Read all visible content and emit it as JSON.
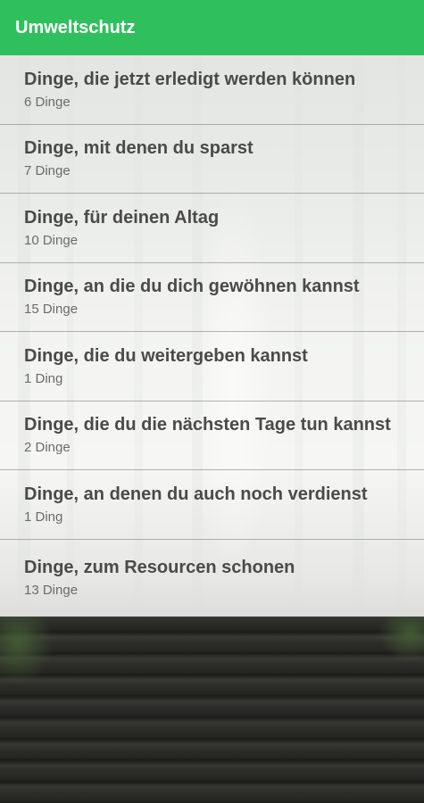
{
  "appbar": {
    "title": "Umweltschutz",
    "color": "#2fc05d"
  },
  "categories": [
    {
      "title": "Dinge, die jetzt erledigt werden können",
      "count": "6 Dinge"
    },
    {
      "title": "Dinge, mit denen du sparst",
      "count": "7 Dinge"
    },
    {
      "title": "Dinge, für deinen Altag",
      "count": "10 Dinge"
    },
    {
      "title": "Dinge, an die du dich gewöhnen kannst",
      "count": "15 Dinge"
    },
    {
      "title": "Dinge, die du weitergeben kannst",
      "count": "1 Ding"
    },
    {
      "title": "Dinge, die du die nächsten Tage tun kannst",
      "count": "2 Dinge"
    },
    {
      "title": "Dinge, an denen du auch noch verdienst",
      "count": "1 Ding"
    },
    {
      "title": "Dinge, zum Resourcen schonen",
      "count": "13 Dinge"
    }
  ]
}
